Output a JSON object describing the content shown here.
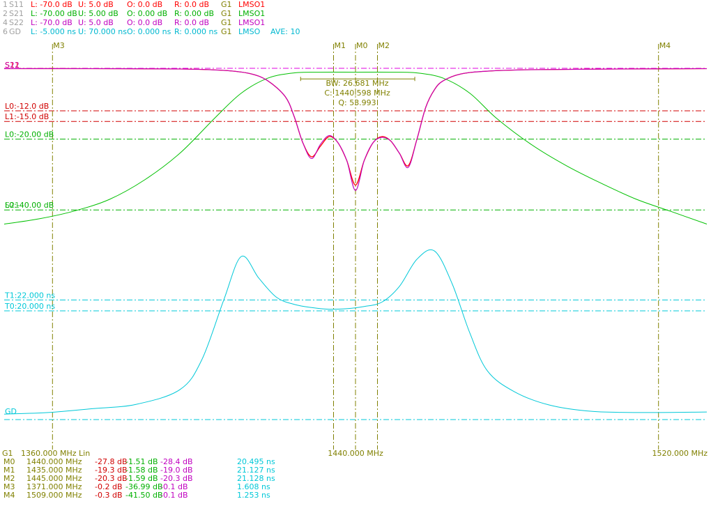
{
  "colors": {
    "s11": "#ff0000",
    "s21": "#00c000",
    "s22": "#c000c0",
    "gd": "#00c8d8",
    "marker": "#808000",
    "limit_red": "#d00000",
    "limit_green": "#00b000",
    "label_gray": "#a0a0a0",
    "ref_magenta": "#e000e0"
  },
  "traces_header": [
    {
      "id": "1",
      "name": "S11",
      "L": "L: -70.0 dB",
      "U": "U:  5.0 dB",
      "O": "O:  0.0 dB",
      "R": "R:  0.0 dB",
      "G": "G1",
      "mode": "LMSO1",
      "ave": ""
    },
    {
      "id": "2",
      "name": "S21",
      "L": "L: -70.00 dB",
      "U": "U:  5.00 dB",
      "O": "O:  0.00 dB",
      "R": "R:  0.00 dB",
      "G": "G1",
      "mode": "LMSO1",
      "ave": ""
    },
    {
      "id": "4",
      "name": "S22",
      "L": "L: -70.0 dB",
      "U": "U:  5.0 dB",
      "O": "O:  0.0 dB",
      "R": "R:  0.0 dB",
      "G": "G1",
      "mode": "LMSO1",
      "ave": ""
    },
    {
      "id": "6",
      "name": "GD",
      "L": "L: -5.000 ns",
      "U": "U: 70.000 ns",
      "O": "O:  0.000 ns",
      "R": "R:  0.000 ns",
      "G": "G1",
      "mode": "LMSO",
      "ave": "AVE:  10"
    }
  ],
  "chart_data": {
    "type": "line",
    "x_unit": "MHz",
    "x_start": 1360.0,
    "x_stop": 1520.0,
    "x_center": 1440.0,
    "x_scale": "Lin",
    "x_tick_labels": {
      "start": "1360.000 MHz",
      "center": "1440.000 MHz",
      "stop": "1520.000 MHz"
    },
    "gate_label": "G1",
    "start_label": "1360.000 MHz  Lin",
    "ref_labels": {
      "s11": "S11",
      "s22": "S22",
      "gd": "GD"
    },
    "db_scale": {
      "top": 5.0,
      "bottom": -70.0
    },
    "gd_scale": {
      "top": 70.0,
      "bottom": -5.0
    },
    "limit_lines": [
      {
        "label": "L0:-12.0 dB",
        "value": -12.0,
        "trace": "S11"
      },
      {
        "label": "L1:-15.0 dB",
        "value": -15.0,
        "trace": "S11"
      },
      {
        "label": "L0:-20.00 dB",
        "value": -20.0,
        "trace": "S21"
      },
      {
        "label": "L0:-40.00 dB",
        "value": -40.0,
        "trace": "S21"
      },
      {
        "label": "T1:22.000 ns",
        "value": 22.0,
        "trace": "GD"
      },
      {
        "label": "T0:20.000 ns",
        "value": 20.0,
        "trace": "GD"
      }
    ],
    "overlap_label": "S21",
    "bw_box": {
      "bw": "BW:  26.681 MHz",
      "center": "C: 1440.598 MHz",
      "q": "Q:  53.993"
    },
    "markers_x": [
      {
        "name": "M3",
        "freq": 1371.0
      },
      {
        "name": "M1",
        "freq": 1435.0
      },
      {
        "name": "M0",
        "freq": 1440.0
      },
      {
        "name": "M2",
        "freq": 1445.0
      },
      {
        "name": "M4",
        "freq": 1509.0
      }
    ],
    "series": [
      {
        "name": "S21",
        "x": [
          1360,
          1368,
          1376,
          1384,
          1392,
          1400,
          1408,
          1414,
          1420,
          1426,
          1432,
          1440,
          1448,
          1454,
          1460,
          1466,
          1472,
          1480,
          1488,
          1496,
          1504,
          1512,
          1520
        ],
        "y": [
          -44,
          -42.5,
          -40.3,
          -37,
          -31.5,
          -24,
          -14,
          -7,
          -2.8,
          -1.3,
          -1.1,
          -1.1,
          -1.1,
          -1.3,
          -2.8,
          -7,
          -14,
          -21.5,
          -27.5,
          -32.5,
          -37,
          -40.5,
          -44
        ]
      },
      {
        "name": "S11",
        "x": [
          1360,
          1380,
          1400,
          1410,
          1416,
          1420,
          1424,
          1426,
          1428,
          1430,
          1432,
          1434,
          1436,
          1438,
          1440,
          1442,
          1444,
          1446,
          1448,
          1450,
          1452,
          1454,
          1456,
          1458,
          1460,
          1464,
          1470,
          1480,
          1500,
          1520
        ],
        "y": [
          -0.1,
          -0.1,
          -0.2,
          -0.6,
          -1.5,
          -3.5,
          -8,
          -13.5,
          -21,
          -25,
          -22,
          -19.3,
          -21,
          -26,
          -33,
          -26,
          -21,
          -19.3,
          -20.5,
          -24,
          -27.5,
          -20,
          -11,
          -6,
          -3.5,
          -1.6,
          -0.8,
          -0.4,
          -0.2,
          -0.1
        ]
      },
      {
        "name": "S22",
        "x": [
          1360,
          1380,
          1400,
          1410,
          1416,
          1420,
          1424,
          1426,
          1428,
          1430,
          1432,
          1434,
          1436,
          1438,
          1440,
          1442,
          1444,
          1446,
          1448,
          1450,
          1452,
          1454,
          1456,
          1458,
          1460,
          1464,
          1470,
          1480,
          1500,
          1520
        ],
        "y": [
          -0.1,
          -0.1,
          -0.2,
          -0.6,
          -1.5,
          -3.5,
          -8,
          -13.5,
          -21,
          -25.5,
          -21.5,
          -19.0,
          -21,
          -26,
          -34.5,
          -26,
          -21,
          -19.5,
          -20.5,
          -24,
          -28,
          -20,
          -11,
          -6,
          -3.5,
          -1.6,
          -0.8,
          -0.4,
          -0.2,
          -0.1
        ]
      },
      {
        "name": "GD",
        "x": [
          1360,
          1370,
          1380,
          1390,
          1400,
          1405,
          1410,
          1414,
          1418,
          1422,
          1426,
          1430,
          1434,
          1438,
          1442,
          1446,
          1450,
          1454,
          1458,
          1462,
          1466,
          1470,
          1476,
          1484,
          1494,
          1506,
          1520
        ],
        "y": [
          1.0,
          1.3,
          2.0,
          2.8,
          5.5,
          11,
          22,
          30,
          26,
          22.5,
          21.2,
          20.6,
          20.3,
          20.4,
          20.8,
          21.6,
          24.5,
          29.5,
          31,
          25,
          16,
          9,
          5.2,
          2.7,
          1.5,
          1.3,
          1.4
        ]
      }
    ]
  },
  "marker_table": [
    {
      "name": "M0",
      "freq": "1440.000 MHz",
      "s11": "-27.8 dB",
      "s21": "-1.51 dB",
      "s22": "-28.4 dB",
      "gd": "20.495 ns"
    },
    {
      "name": "M1",
      "freq": "1435.000 MHz",
      "s11": "-19.3 dB",
      "s21": "-1.58 dB",
      "s22": "-19.0 dB",
      "gd": "21.127 ns"
    },
    {
      "name": "M2",
      "freq": "1445.000 MHz",
      "s11": "-20.3 dB",
      "s21": "-1.59 dB",
      "s22": "-20.3 dB",
      "gd": "21.128 ns"
    },
    {
      "name": "M3",
      "freq": "1371.000 MHz",
      "s11": "-0.2 dB",
      "s21": "-36.99 dB",
      "s22": "-0.1 dB",
      "gd": "1.608 ns"
    },
    {
      "name": "M4",
      "freq": "1509.000 MHz",
      "s11": "-0.3 dB",
      "s21": "-41.50 dB",
      "s22": "-0.1 dB",
      "gd": "1.253 ns"
    }
  ]
}
